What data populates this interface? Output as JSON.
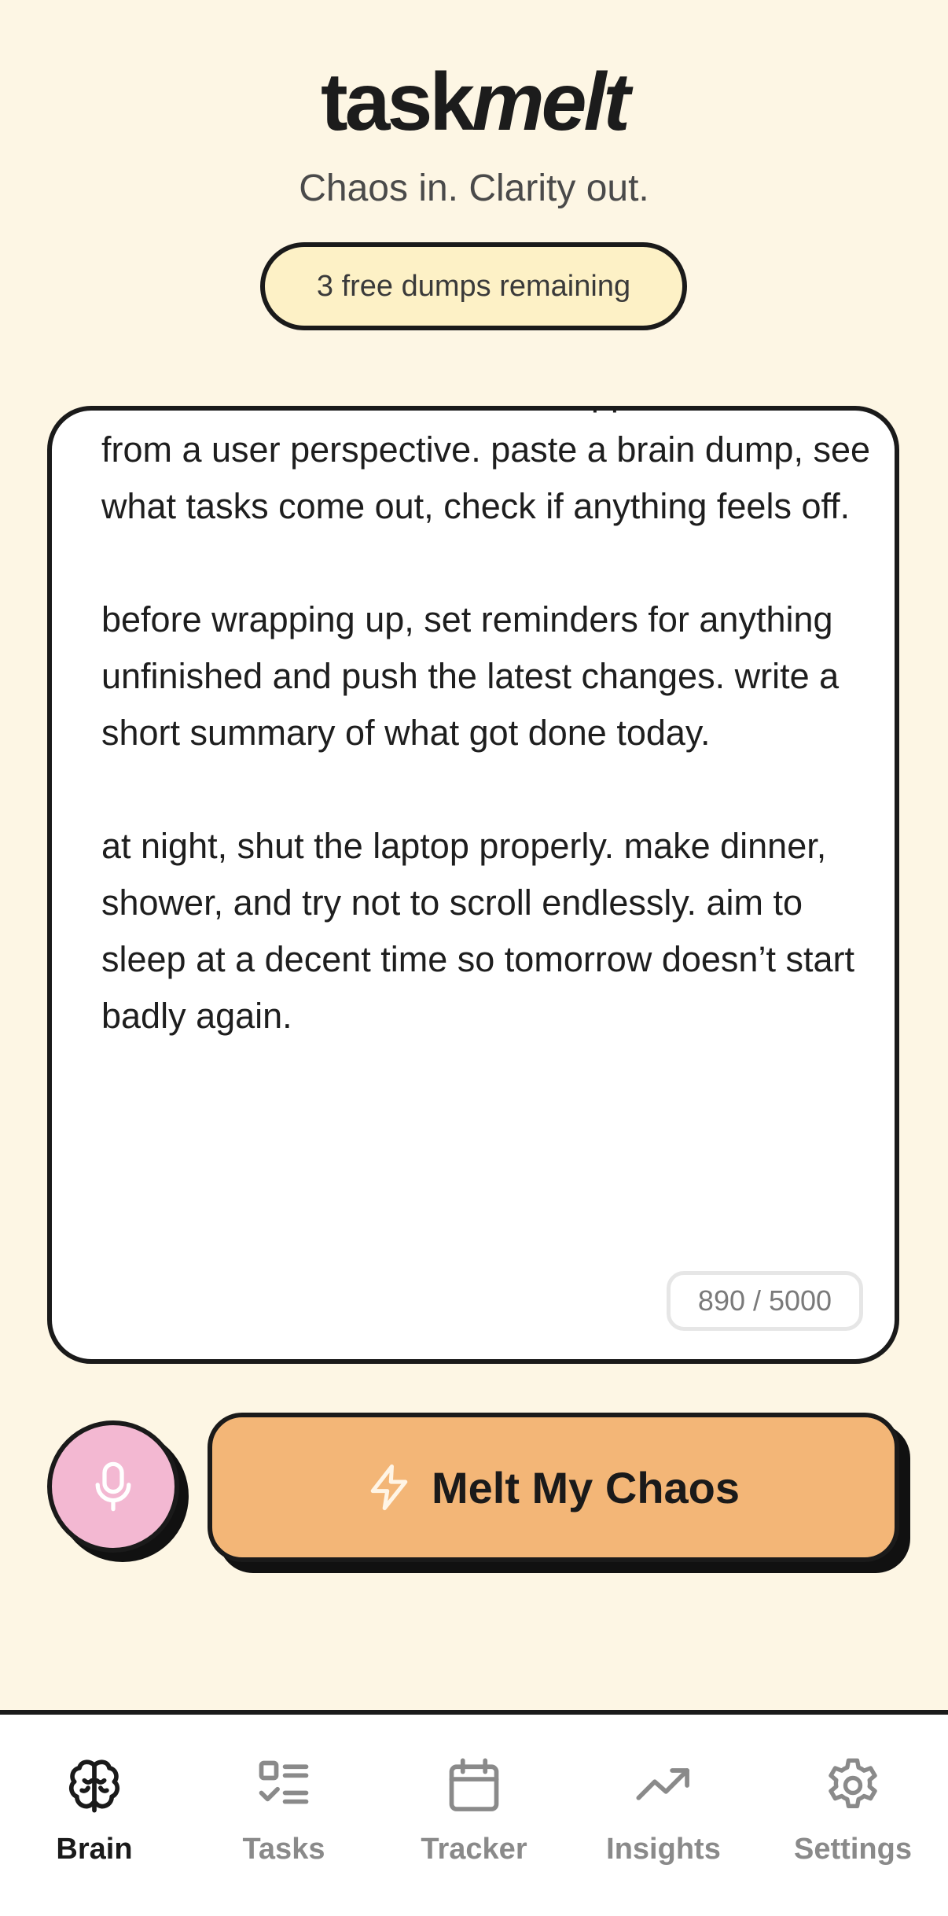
{
  "header": {
    "logo_regular": "task",
    "logo_italic": "melt",
    "tagline": "Chaos in. Clarity out.",
    "badge": "3 free dumps remaining"
  },
  "editor": {
    "paragraphs": [
      "later in the afternoon, test the app once more from a user perspective. paste a brain dump, see what tasks come out, check if anything feels off.",
      "before wrapping up, set reminders for anything unfinished and push the latest changes. write a short summary of what got done today.",
      "at night, shut the laptop properly. make dinner, shower, and try not to scroll endlessly. aim to sleep at a decent time so tomorrow doesn’t start badly again."
    ],
    "char_count": "890 / 5000"
  },
  "actions": {
    "mic_icon": "microphone-icon",
    "melt_icon": "lightning-icon",
    "melt_label": "Melt My Chaos"
  },
  "nav": {
    "items": [
      {
        "label": "Brain",
        "icon": "brain-icon",
        "active": true
      },
      {
        "label": "Tasks",
        "icon": "checklist-icon",
        "active": false
      },
      {
        "label": "Tracker",
        "icon": "calendar-icon",
        "active": false
      },
      {
        "label": "Insights",
        "icon": "trending-up-icon",
        "active": false
      },
      {
        "label": "Settings",
        "icon": "gear-icon",
        "active": false
      }
    ]
  },
  "colors": {
    "background": "#fdf6e4",
    "badge_bg": "#fdf1c6",
    "melt_button": "#f3b677",
    "mic_button": "#f3b8d2",
    "border": "#1a1a1a"
  }
}
